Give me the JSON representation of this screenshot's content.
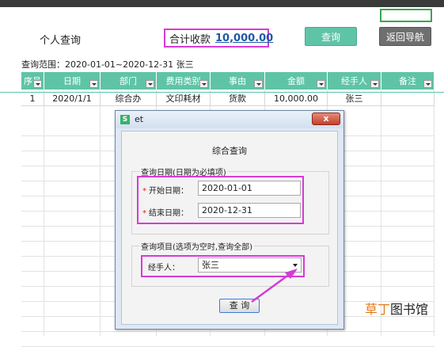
{
  "header": {
    "title": "个人查询",
    "total_label": "合计收款",
    "total_value": "10,000.00",
    "query_button": "查询",
    "back_button": "返回导航",
    "range_text": "查询范围：2020-01-01~2020-12-31 张三"
  },
  "table": {
    "columns": [
      "序号",
      "日期",
      "部门",
      "费用类别",
      "事由",
      "金额",
      "经手人",
      "备注"
    ],
    "rows": [
      [
        "1",
        "2020/1/1",
        "综合办",
        "文印耗材",
        "货款",
        "10,000.00",
        "张三",
        ""
      ]
    ]
  },
  "dialog": {
    "app_name": "et",
    "icon_letter": "S",
    "close_symbol": "x",
    "heading": "综合查询",
    "date_group_label": "查询日期(日期为必填项)",
    "start_label": "开始日期：",
    "start_value": "2020-01-01",
    "end_label": "结束日期：",
    "end_value": "2020-12-31",
    "items_group_label": "查询项目(选项为空时,查询全部)",
    "handler_label": "经手人：",
    "handler_value": "张三",
    "query_button": "查 询"
  },
  "watermark": {
    "part1": "草丁",
    "part2": "图书馆"
  },
  "colors": {
    "header_green": "#5fc4a6",
    "highlight_magenta": "#d63bd6",
    "total_blue": "#1f5aa6"
  },
  "icons": [
    "dropdown-arrow-icon",
    "et-app-icon",
    "close-icon",
    "select-arrow-icon",
    "annotation-arrow-icon"
  ]
}
